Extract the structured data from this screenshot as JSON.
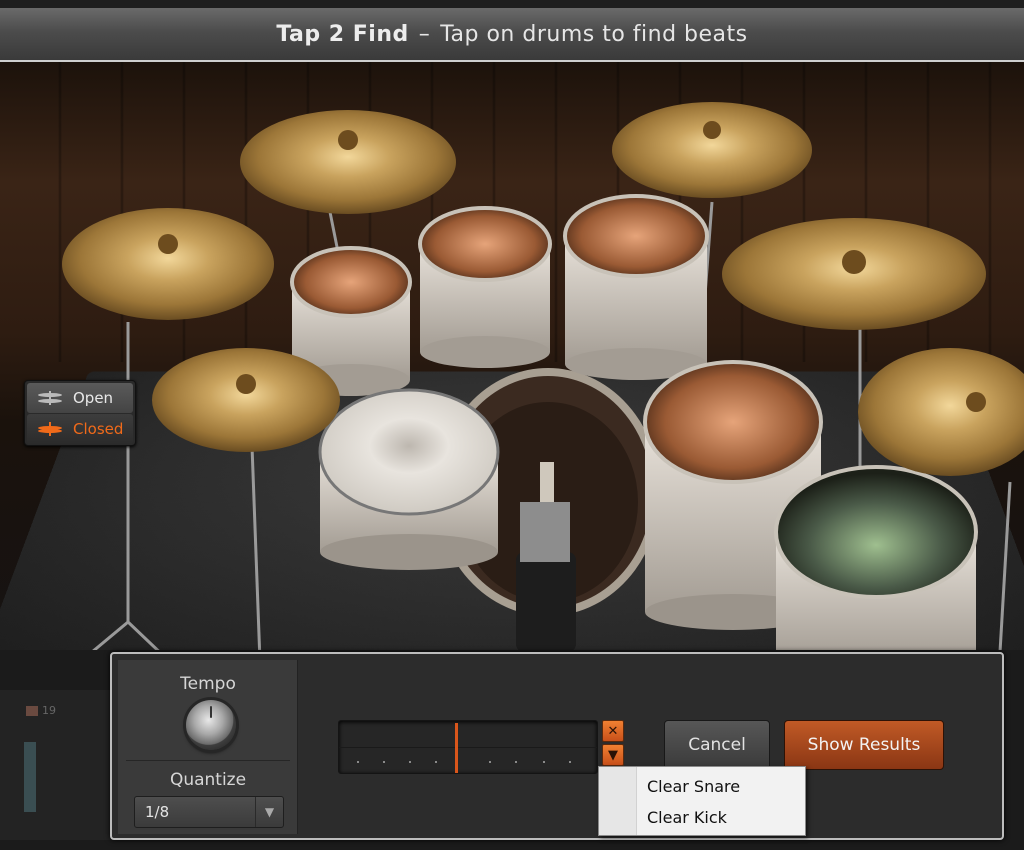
{
  "window": {
    "title_bold": "Tap 2 Find",
    "title_sep": "–",
    "title_rest": "Tap on drums to find beats"
  },
  "hihat": {
    "open_label": "Open",
    "closed_label": "Closed",
    "selected": "Closed"
  },
  "tempo": {
    "label": "Tempo"
  },
  "quantize": {
    "label": "Quantize",
    "value": "1/8"
  },
  "pattern": {
    "clear_icon": "close-icon",
    "menu_icon": "chevron-down-icon"
  },
  "buttons": {
    "cancel": "Cancel",
    "show_results": "Show Results"
  },
  "clear_menu": {
    "items": [
      "Clear Snare",
      "Clear Kick"
    ]
  },
  "background": {
    "bar_number": "19"
  },
  "colors": {
    "accent": "#e2621e",
    "panel": "#2c2c2c"
  }
}
